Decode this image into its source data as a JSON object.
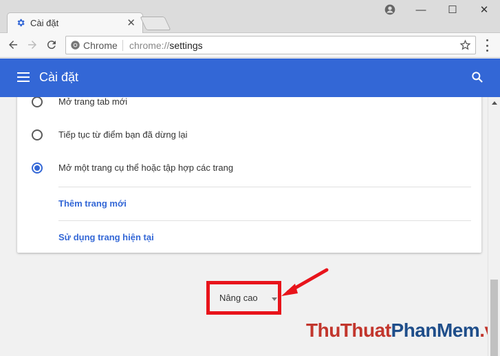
{
  "tab": {
    "title": "Cài đặt",
    "close_glyph": "✕"
  },
  "window_controls": {
    "minimize": "—",
    "maximize": "☐",
    "close": "✕"
  },
  "omnibox": {
    "chip": "Chrome",
    "url_scheme": "chrome://",
    "url_path": "settings"
  },
  "header": {
    "title": "Cài đặt"
  },
  "startup_options": [
    {
      "label": "Mở trang tab mới",
      "checked": false
    },
    {
      "label": "Tiếp tục từ điểm bạn đã dừng lại",
      "checked": false
    },
    {
      "label": "Mở một trang cụ thể hoặc tập hợp các trang",
      "checked": true
    }
  ],
  "links": {
    "add_page": "Thêm trang mới",
    "use_current": "Sử dụng trang hiện tại"
  },
  "advanced": {
    "label": "Nâng cao"
  },
  "watermark": {
    "part1": "ThuThuat",
    "part2": "PhanMem",
    "part3": ".vn"
  },
  "colors": {
    "accent": "#3367d6",
    "highlight": "#e8141b",
    "watermark_red": "#c2362d",
    "watermark_blue": "#1f4e8a"
  },
  "icons": [
    "gear-icon",
    "close-icon",
    "user-icon",
    "minimize-icon",
    "maximize-icon",
    "back-arrow-icon",
    "forward-arrow-icon",
    "reload-icon",
    "chrome-logo-icon",
    "star-icon",
    "more-vert-icon",
    "menu-icon",
    "search-icon",
    "chevron-down-icon",
    "scroll-up-icon"
  ]
}
